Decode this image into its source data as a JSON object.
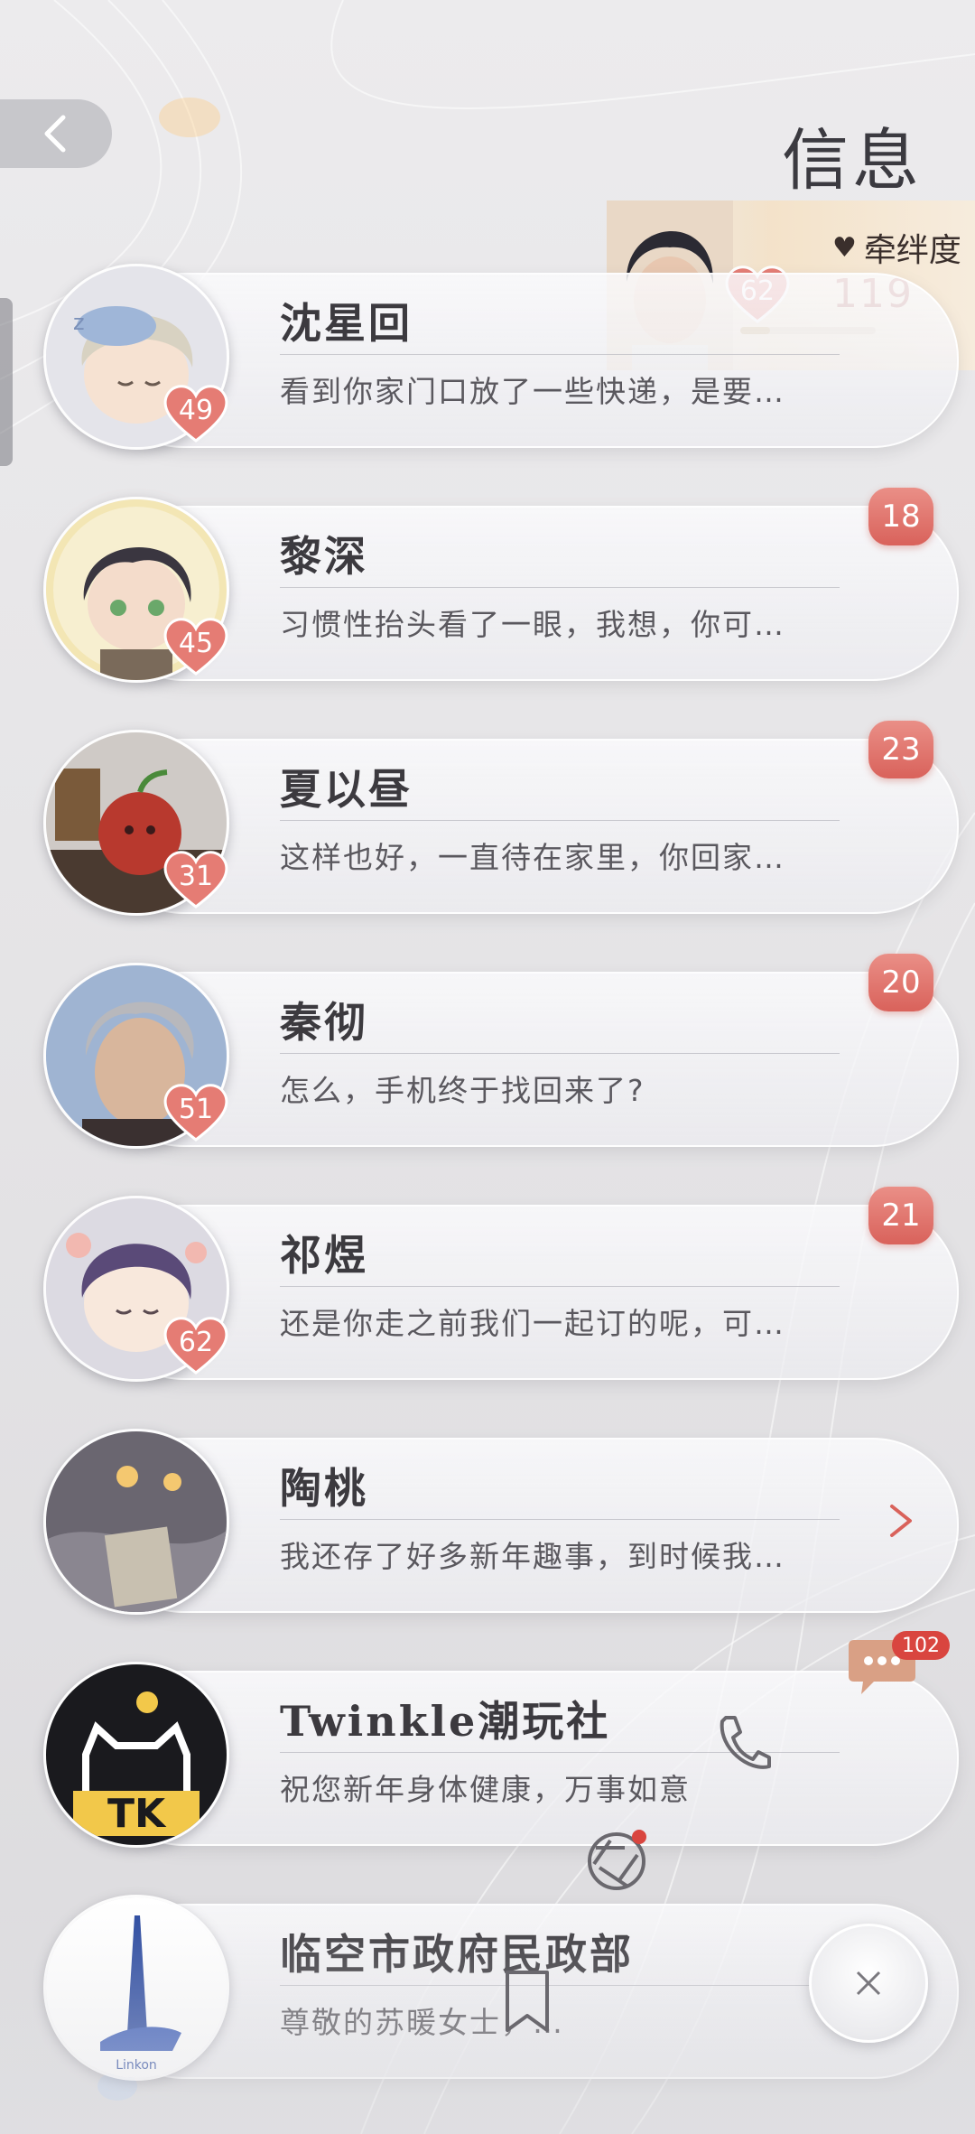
{
  "header": {
    "title": "信息"
  },
  "bond": {
    "label": "牵绊度",
    "value": "119",
    "level": "62",
    "progress": 0.22
  },
  "contacts": [
    {
      "name": "沈星回",
      "message": "看到你家门口放了一些快递，是要…",
      "level": "49",
      "unread": ""
    },
    {
      "name": "黎深",
      "message": "习惯性抬头看了一眼，我想，你可…",
      "level": "45",
      "unread": "18"
    },
    {
      "name": "夏以昼",
      "message": "这样也好，一直待在家里，你回家…",
      "level": "31",
      "unread": "23"
    },
    {
      "name": "秦彻",
      "message": "怎么，手机终于找回来了?",
      "level": "51",
      "unread": "20"
    },
    {
      "name": "祁煜",
      "message": "还是你走之前我们一起订的呢，可…",
      "level": "62",
      "unread": "21"
    },
    {
      "name": "陶桃",
      "message": "我还存了好多新年趣事，到时候我…",
      "level": "",
      "unread": ""
    },
    {
      "name": "Twinkle潮玩社",
      "message": "祝您新年身体健康，万事如意",
      "level": "",
      "unread": "",
      "avatar_text": "TK"
    },
    {
      "name": "临空市政府民政部",
      "message": "尊敬的苏暖女士，…",
      "level": "",
      "unread": "",
      "avatar_text": "Linkon"
    }
  ],
  "floating": {
    "chat_badge": "102"
  },
  "colors": {
    "accent": "#d9625b",
    "text": "#3c3a3f",
    "bond_value": "#b45e58"
  }
}
